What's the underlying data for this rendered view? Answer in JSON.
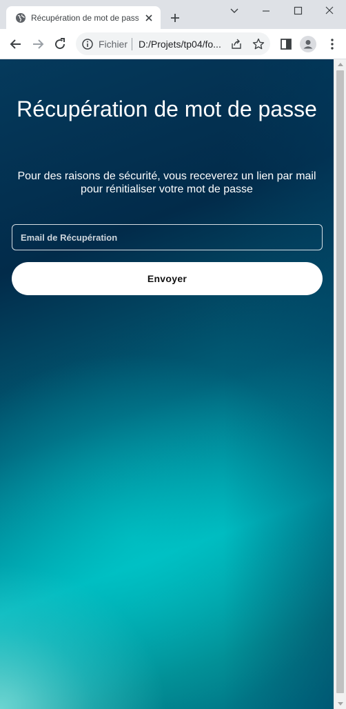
{
  "browser": {
    "tab_title": "Récupération de mot de passe",
    "omnibox_scheme": "Fichier",
    "omnibox_url": "D:/Projets/tp04/fo...",
    "icons": {
      "favicon": "globe-icon",
      "tab_close": "close-icon",
      "new_tab": "plus-icon",
      "back": "back-arrow-icon",
      "forward": "forward-arrow-icon",
      "reload": "reload-icon",
      "info": "info-icon",
      "share": "share-icon",
      "bookmark": "star-icon",
      "side_panel": "side-panel-icon",
      "profile": "profile-avatar-icon",
      "menu": "kebab-menu-icon",
      "minimize": "minimize-icon",
      "maximize": "maximize-icon",
      "close_window": "close-window-icon",
      "tab_search": "chevron-down-icon"
    }
  },
  "page": {
    "title": "Récupération de mot de passe",
    "description": "Pour des raisons de sécurité, vous receverez un lien par mail pour rénitialiser votre mot de passe",
    "email_placeholder": "Email de Récupération",
    "email_value": "",
    "submit_label": "Envoyer"
  },
  "colors": {
    "gradient_dark": "#022b4a",
    "gradient_teal": "#00b7bd",
    "gradient_light": "#78dcd7",
    "button_bg": "#ffffff",
    "text": "#ffffff"
  }
}
